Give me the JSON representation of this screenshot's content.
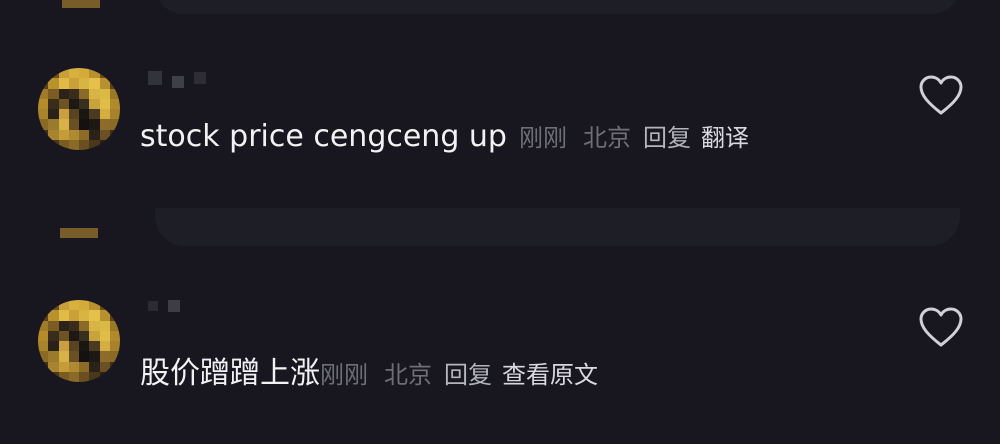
{
  "comments": [
    {
      "body": "stock price cengceng up",
      "time": "刚刚",
      "location": "北京",
      "reply_label": "回复",
      "extra_action": "翻译",
      "like_icon": "heart-outline-icon"
    },
    {
      "body": "股价蹭蹭上涨",
      "time": "刚刚",
      "location": "北京",
      "reply_label": "回复",
      "extra_action": "查看原文",
      "like_icon": "heart-outline-icon"
    }
  ],
  "colors": {
    "background": "#18171f",
    "bubble": "#1e1e27",
    "body_text": "#f2f2f4",
    "meta_text": "#6e6e78",
    "action_text": "#b4b4bc",
    "icon": "#d0d0d6"
  }
}
